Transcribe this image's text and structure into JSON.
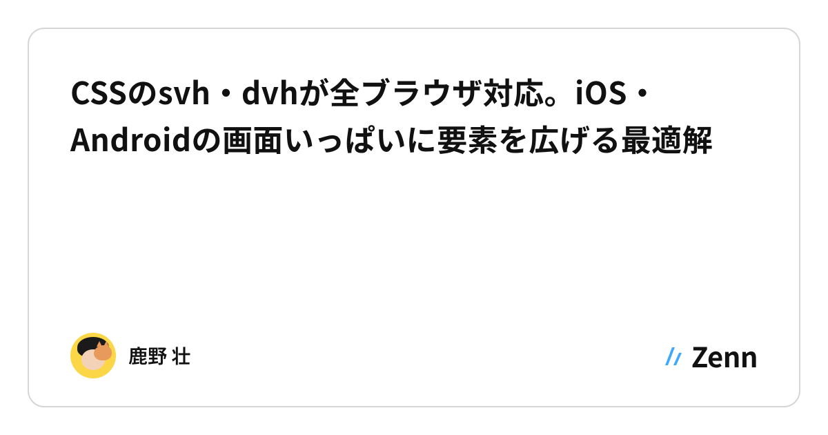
{
  "article": {
    "title": "CSSのsvh・dvhが全ブラウザ対応。iOS・Androidの画面いっぱいに要素を広げる最適解"
  },
  "author": {
    "name": "鹿野 壮"
  },
  "platform": {
    "name": "Zenn"
  }
}
